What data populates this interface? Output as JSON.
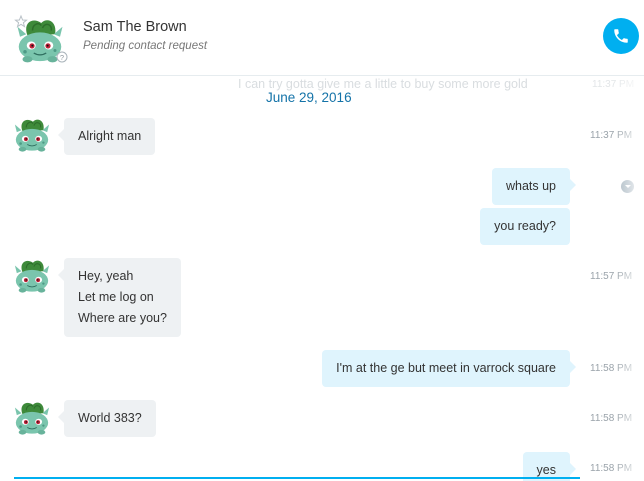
{
  "header": {
    "contact_name": "Sam The Brown",
    "contact_status": "Pending contact request",
    "avatar_icon": "bulbasaur-avatar-icon",
    "call_icon": "phone-icon",
    "accent_color": "#00aff0"
  },
  "conversation": {
    "ghost_text": "I can try gotta give me a little to buy some more gold",
    "ghost_time": "11:37 PM",
    "date_separator": "June 29, 2016",
    "messages": [
      {
        "sender": "contact",
        "lines": [
          "Alright man"
        ],
        "time": "11:37 PM"
      },
      {
        "sender": "me",
        "lines": [
          "whats up"
        ],
        "time": ""
      },
      {
        "sender": "me",
        "lines": [
          "you ready?"
        ],
        "time": ""
      },
      {
        "sender": "contact",
        "lines": [
          "Hey, yeah",
          "Let me log on",
          "Where are you?"
        ],
        "time": "11:57 PM"
      },
      {
        "sender": "me",
        "lines": [
          "I'm at the ge but meet in varrock square"
        ],
        "time": "11:58 PM"
      },
      {
        "sender": "contact",
        "lines": [
          "World 383?"
        ],
        "time": "11:58 PM"
      },
      {
        "sender": "me",
        "lines": [
          "yes"
        ],
        "time": "11:58 PM"
      }
    ]
  }
}
